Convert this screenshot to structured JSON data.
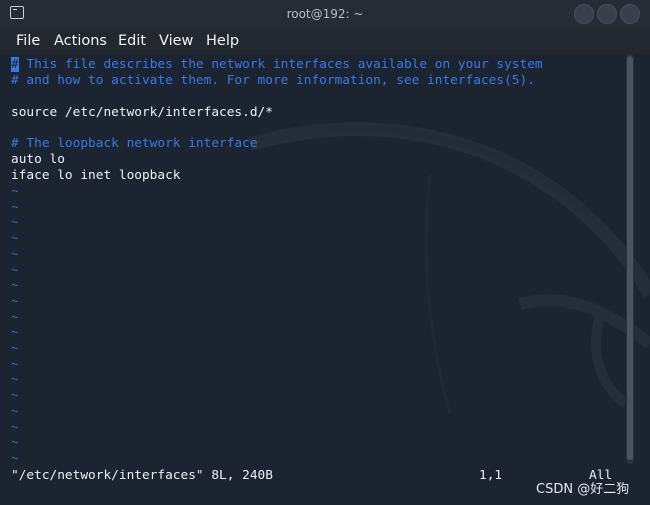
{
  "window": {
    "title": "root@192: ~"
  },
  "menu": {
    "items": [
      "File",
      "Actions",
      "Edit",
      "View",
      "Help"
    ]
  },
  "editor": {
    "cursor_char": "#",
    "lines": [
      {
        "text": " This file describes the network interfaces available on your system",
        "kind": "comment-cursor"
      },
      {
        "text": "# and how to activate them. For more information, see interfaces(5).",
        "kind": "comment"
      },
      {
        "text": "",
        "kind": "normal"
      },
      {
        "text": "source /etc/network/interfaces.d/*",
        "kind": "normal"
      },
      {
        "text": "",
        "kind": "normal"
      },
      {
        "text": "# The loopback network interface",
        "kind": "comment"
      },
      {
        "text": "auto lo",
        "kind": "normal"
      },
      {
        "text": "iface lo inet loopback",
        "kind": "normal"
      }
    ],
    "empty_line_marker": "~",
    "empty_line_count": 18
  },
  "statusline": {
    "file_info": "\"/etc/network/interfaces\" 8L, 240B",
    "position": "1,1",
    "scroll": "All"
  },
  "watermark": "CSDN @好二狗",
  "colors": {
    "background": "#1d2431",
    "comment": "#3a78e7",
    "tilde": "#2d64c8",
    "text": "#eef1f5"
  }
}
